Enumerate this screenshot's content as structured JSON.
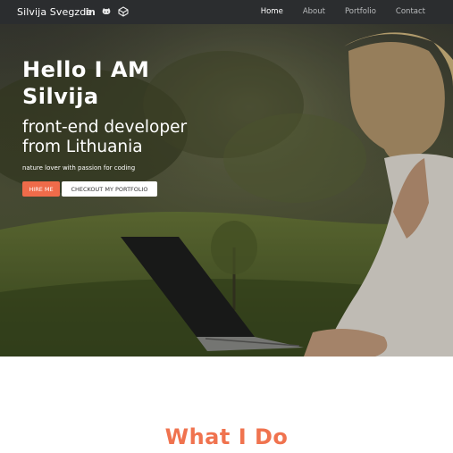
{
  "nav": {
    "brand": "Silvija Svegzde",
    "social_icons": [
      "linkedin-icon",
      "github-icon",
      "codepen-icon"
    ],
    "linkedin_text": "in",
    "links": [
      "Home",
      "About",
      "Portfolio",
      "Contact"
    ],
    "active": "Home"
  },
  "hero": {
    "title": "Hello I AM Silvija",
    "subtitle": "front-end developer from Lithuania",
    "tagline": "nature lover with passion for coding",
    "buttons": {
      "hire": "HIRE ME",
      "portfolio": "CHECKOUT MY PORTFOLIO"
    }
  },
  "sections": {
    "what_i_do": "What I Do"
  },
  "colors": {
    "navbar": "#2b2d2f",
    "accent": "#ef6b4a",
    "heading_accent": "#f0734f"
  }
}
